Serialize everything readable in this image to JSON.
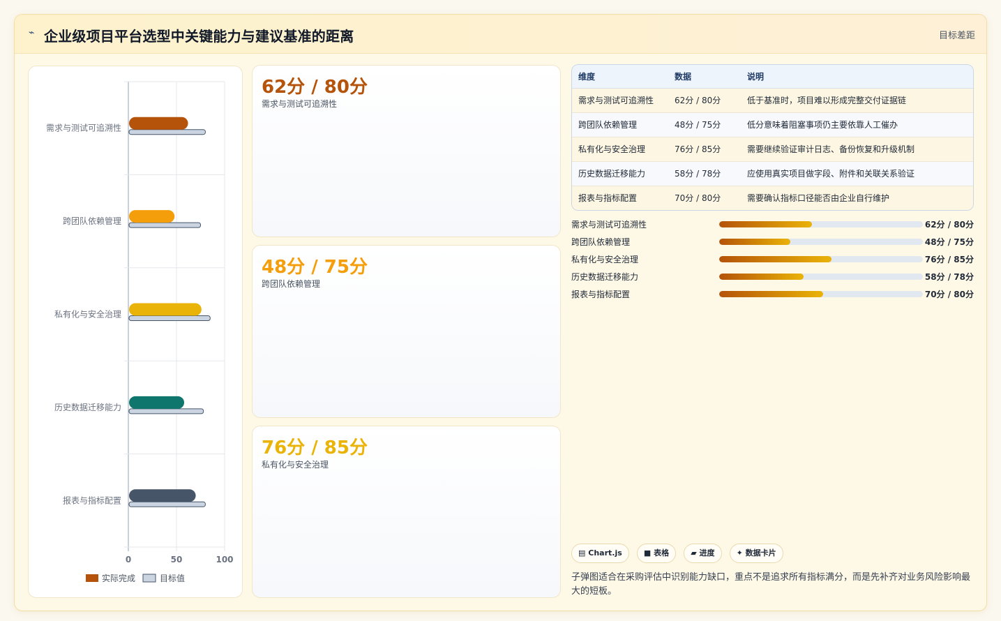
{
  "header": {
    "icon": "chart-trend-icon",
    "title": "企业级项目平台选型中关键能力与建议基准的距离",
    "right_tag": "目标差距"
  },
  "colors": {
    "orange_dark": "#b45309",
    "amber": "#f59e0b",
    "gold": "#eab308",
    "teal": "#0f766e",
    "slate": "#475569",
    "target": "#cbd5e1"
  },
  "chart_data": {
    "type": "bar",
    "orientation": "horizontal",
    "categories": [
      "需求与测试可追溯性",
      "跨团队依赖管理",
      "私有化与安全治理",
      "历史数据迁移能力",
      "报表与指标配置"
    ],
    "series": [
      {
        "name": "实际完成",
        "values": [
          62,
          48,
          76,
          58,
          70
        ]
      },
      {
        "name": "目标值",
        "values": [
          80,
          75,
          85,
          78,
          80
        ]
      }
    ],
    "xlim": [
      0,
      100
    ],
    "xticks": [
      "0",
      "50",
      "100"
    ],
    "grid": true,
    "legend_position": "bottom"
  },
  "cards": [
    {
      "big": "62分 / 80分",
      "sub": "需求与测试可追溯性",
      "color": "#b45309"
    },
    {
      "big": "48分 / 75分",
      "sub": "跨团队依赖管理",
      "color": "#f59e0b"
    },
    {
      "big": "76分 / 85分",
      "sub": "私有化与安全治理",
      "color": "#eab308"
    }
  ],
  "table": {
    "headers": [
      "维度",
      "数据",
      "说明"
    ],
    "rows": [
      [
        "需求与测试可追溯性",
        "62分 / 80分",
        "低于基准时，项目难以形成完整交付证据链"
      ],
      [
        "跨团队依赖管理",
        "48分 / 75分",
        "低分意味着阻塞事项仍主要依靠人工催办"
      ],
      [
        "私有化与安全治理",
        "76分 / 85分",
        "需要继续验证审计日志、备份恢复和升级机制"
      ],
      [
        "历史数据迁移能力",
        "58分 / 78分",
        "应使用真实项目做字段、附件和关联关系验证"
      ],
      [
        "报表与指标配置",
        "70分 / 80分",
        "需要确认指标口径能否由企业自行维护"
      ]
    ]
  },
  "progress": [
    {
      "label": "需求与测试可追溯性",
      "value": "62分 / 80分",
      "fraction": 0.455
    },
    {
      "label": "跨团队依赖管理",
      "value": "48分 / 75分",
      "fraction": 0.35
    },
    {
      "label": "私有化与安全治理",
      "value": "76分 / 85分",
      "fraction": 0.553
    },
    {
      "label": "历史数据迁移能力",
      "value": "58分 / 78分",
      "fraction": 0.415
    },
    {
      "label": "报表与指标配置",
      "value": "70分 / 80分",
      "fraction": 0.51
    }
  ],
  "chips": [
    {
      "icon": "chart-icon",
      "glyph": "▤",
      "label": "Chart.js"
    },
    {
      "icon": "table-icon",
      "glyph": "■",
      "label": "表格"
    },
    {
      "icon": "progress-icon",
      "glyph": "▰",
      "label": "进度"
    },
    {
      "icon": "sparkle-icon",
      "glyph": "✦",
      "label": "数据卡片"
    }
  ],
  "note": "子弹图适合在采购评估中识别能力缺口，重点不是追求所有指标满分，而是先补齐对业务风险影响最大的短板。"
}
